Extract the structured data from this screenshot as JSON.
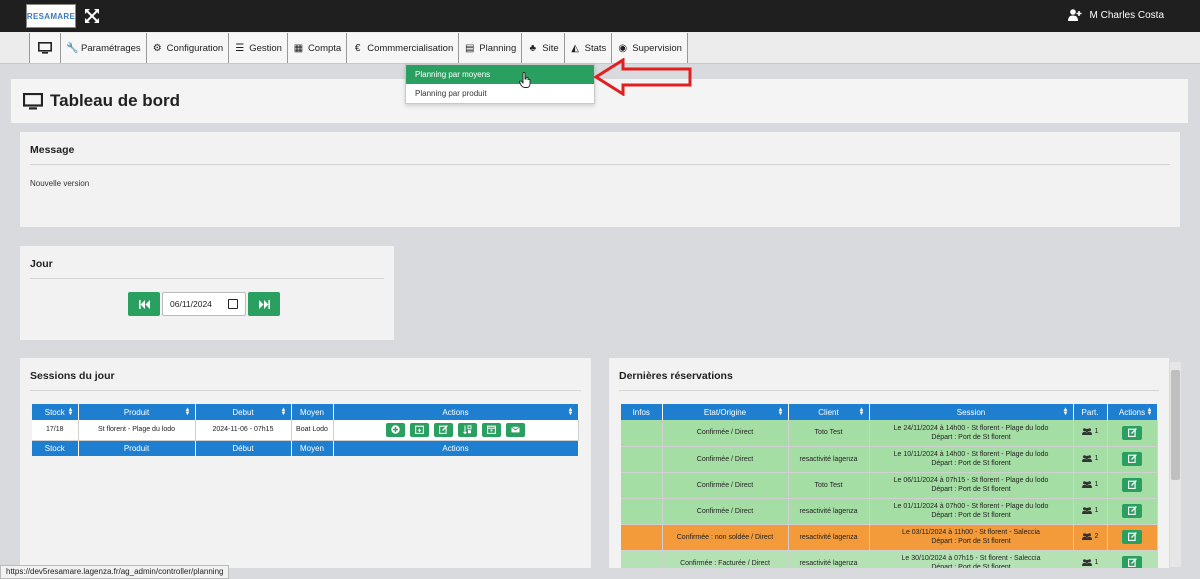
{
  "topbar": {
    "logo_text": "RESAMARE",
    "user_name": "M Charles Costa"
  },
  "nav": {
    "items": [
      {
        "label": "Paramétrages",
        "icon": "wrench-icon"
      },
      {
        "label": "Configuration",
        "icon": "gears-icon"
      },
      {
        "label": "Gestion",
        "icon": "list-icon"
      },
      {
        "label": "Compta",
        "icon": "calculator-icon"
      },
      {
        "label": "Commmercialisation",
        "icon": "euro-icon"
      },
      {
        "label": "Planning",
        "icon": "calendar-icon"
      },
      {
        "label": "Site",
        "icon": "sitemap-icon"
      },
      {
        "label": "Stats",
        "icon": "area-chart-icon"
      },
      {
        "label": "Supervision",
        "icon": "eye-icon"
      }
    ]
  },
  "dropdown": {
    "items": [
      "Planning par moyens",
      "Planning par produit"
    ]
  },
  "page": {
    "title": "Tableau de bord"
  },
  "message": {
    "heading": "Message",
    "text": "Nouvelle version"
  },
  "jour": {
    "heading": "Jour",
    "date_value": "06/11/2024"
  },
  "sessions": {
    "heading": "Sessions du jour",
    "headers": [
      "Stock",
      "Produit",
      "Debut",
      "Moyen",
      "Actions"
    ],
    "footer": [
      "Stock",
      "Produit",
      "Début",
      "Moyen",
      "Actions"
    ],
    "rows": [
      {
        "stock": "17/18",
        "produit": "St florent - Plage du lodo",
        "debut": "2024-11-06 - 07h15",
        "moyen": "Boat Lodo"
      }
    ]
  },
  "reservations": {
    "heading": "Dernières réservations",
    "headers": [
      "Infos",
      "Etat/Origine",
      "Client",
      "Session",
      "Part.",
      "Actions"
    ],
    "rows": [
      {
        "status": "green",
        "etat": "Confirmée / Direct",
        "client": "Toto Test",
        "session_1": "Le 24/11/2024 à 14h00 - St florent - Plage du lodo",
        "session_2": "Départ : Port de St florent",
        "part": "1"
      },
      {
        "status": "green",
        "etat": "Confirmée / Direct",
        "client": "resactivité lagenza",
        "session_1": "Le 10/11/2024 à 14h00 - St florent - Plage du lodo",
        "session_2": "Départ : Port de St florent",
        "part": "1"
      },
      {
        "status": "green",
        "etat": "Confirmée / Direct",
        "client": "Toto Test",
        "session_1": "Le 06/11/2024 à 07h15 - St florent - Plage du lodo",
        "session_2": "Départ : Port de St florent",
        "part": "1"
      },
      {
        "status": "green",
        "etat": "Confirmée / Direct",
        "client": "resactivité lagenza",
        "session_1": "Le 01/11/2024 à 07h00 - St florent - Plage du lodo",
        "session_2": "Départ : Port de St florent",
        "part": "1"
      },
      {
        "status": "orange",
        "etat": "Confirmée : non soldée / Direct",
        "client": "resactivité lagenza",
        "session_1": "Le 03/11/2024 à 11h00 - St florent - Saleccia",
        "session_2": "Départ : Port de St florent",
        "part": "2"
      },
      {
        "status": "lgreen",
        "etat": "Confirmée : Facturée / Direct",
        "client": "resactivité lagenza",
        "session_1": "Le 30/10/2024 à 07h15 - St florent - Saleccia",
        "session_2": "Départ : Port de St florent",
        "part": "1"
      }
    ]
  },
  "statusbar": {
    "url": "https://dev5resamare.lagenza.fr/ag_admin/controller/planning"
  },
  "colors": {
    "accent_green": "#2aa060",
    "header_blue": "#1e7fd0",
    "row_green": "#a5dea5",
    "row_orange": "#f39a3a",
    "arrow_red": "#e02020"
  }
}
